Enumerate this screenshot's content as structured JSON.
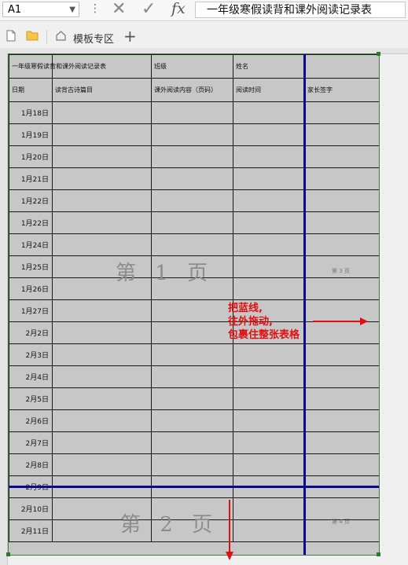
{
  "formula_bar": {
    "name_box": "A1",
    "fx_label": "fx",
    "formula_text": "一年级寒假读背和课外阅读记录表"
  },
  "tabs": {
    "template_label": "模板专区",
    "add_label": "+"
  },
  "sheet": {
    "header_row1": [
      "一年级寒假读背和课外阅读记录表",
      "",
      "班级",
      "姓名",
      ""
    ],
    "header_row2": [
      "日期",
      "读背古诗篇目",
      "课外阅读内容（页码）",
      "阅读时间",
      "家长签字"
    ],
    "dates": [
      "1月18日",
      "1月19日",
      "1月20日",
      "1月21日",
      "1月22日",
      "1月22日",
      "1月24日",
      "1月25日",
      "1月26日",
      "1月27日",
      "2月2日",
      "2月3日",
      "2月4日",
      "2月5日",
      "2月6日",
      "2月7日",
      "2月8日",
      "2月9日",
      "2月10日",
      "2月11日"
    ]
  },
  "page_breaks": {
    "page1_label": "第 1 页",
    "page2_label": "第 2 页",
    "page3_label": "第 3 页",
    "page4_label": "第 4 页"
  },
  "annotation": {
    "line1": "把蓝线,",
    "line2": "往外拖动,",
    "line3": "包裹住整张表格"
  },
  "colors": {
    "page_break_line": "#0a0a8c",
    "annotation": "#e01010",
    "sheet_bg": "#c7c7c7"
  }
}
